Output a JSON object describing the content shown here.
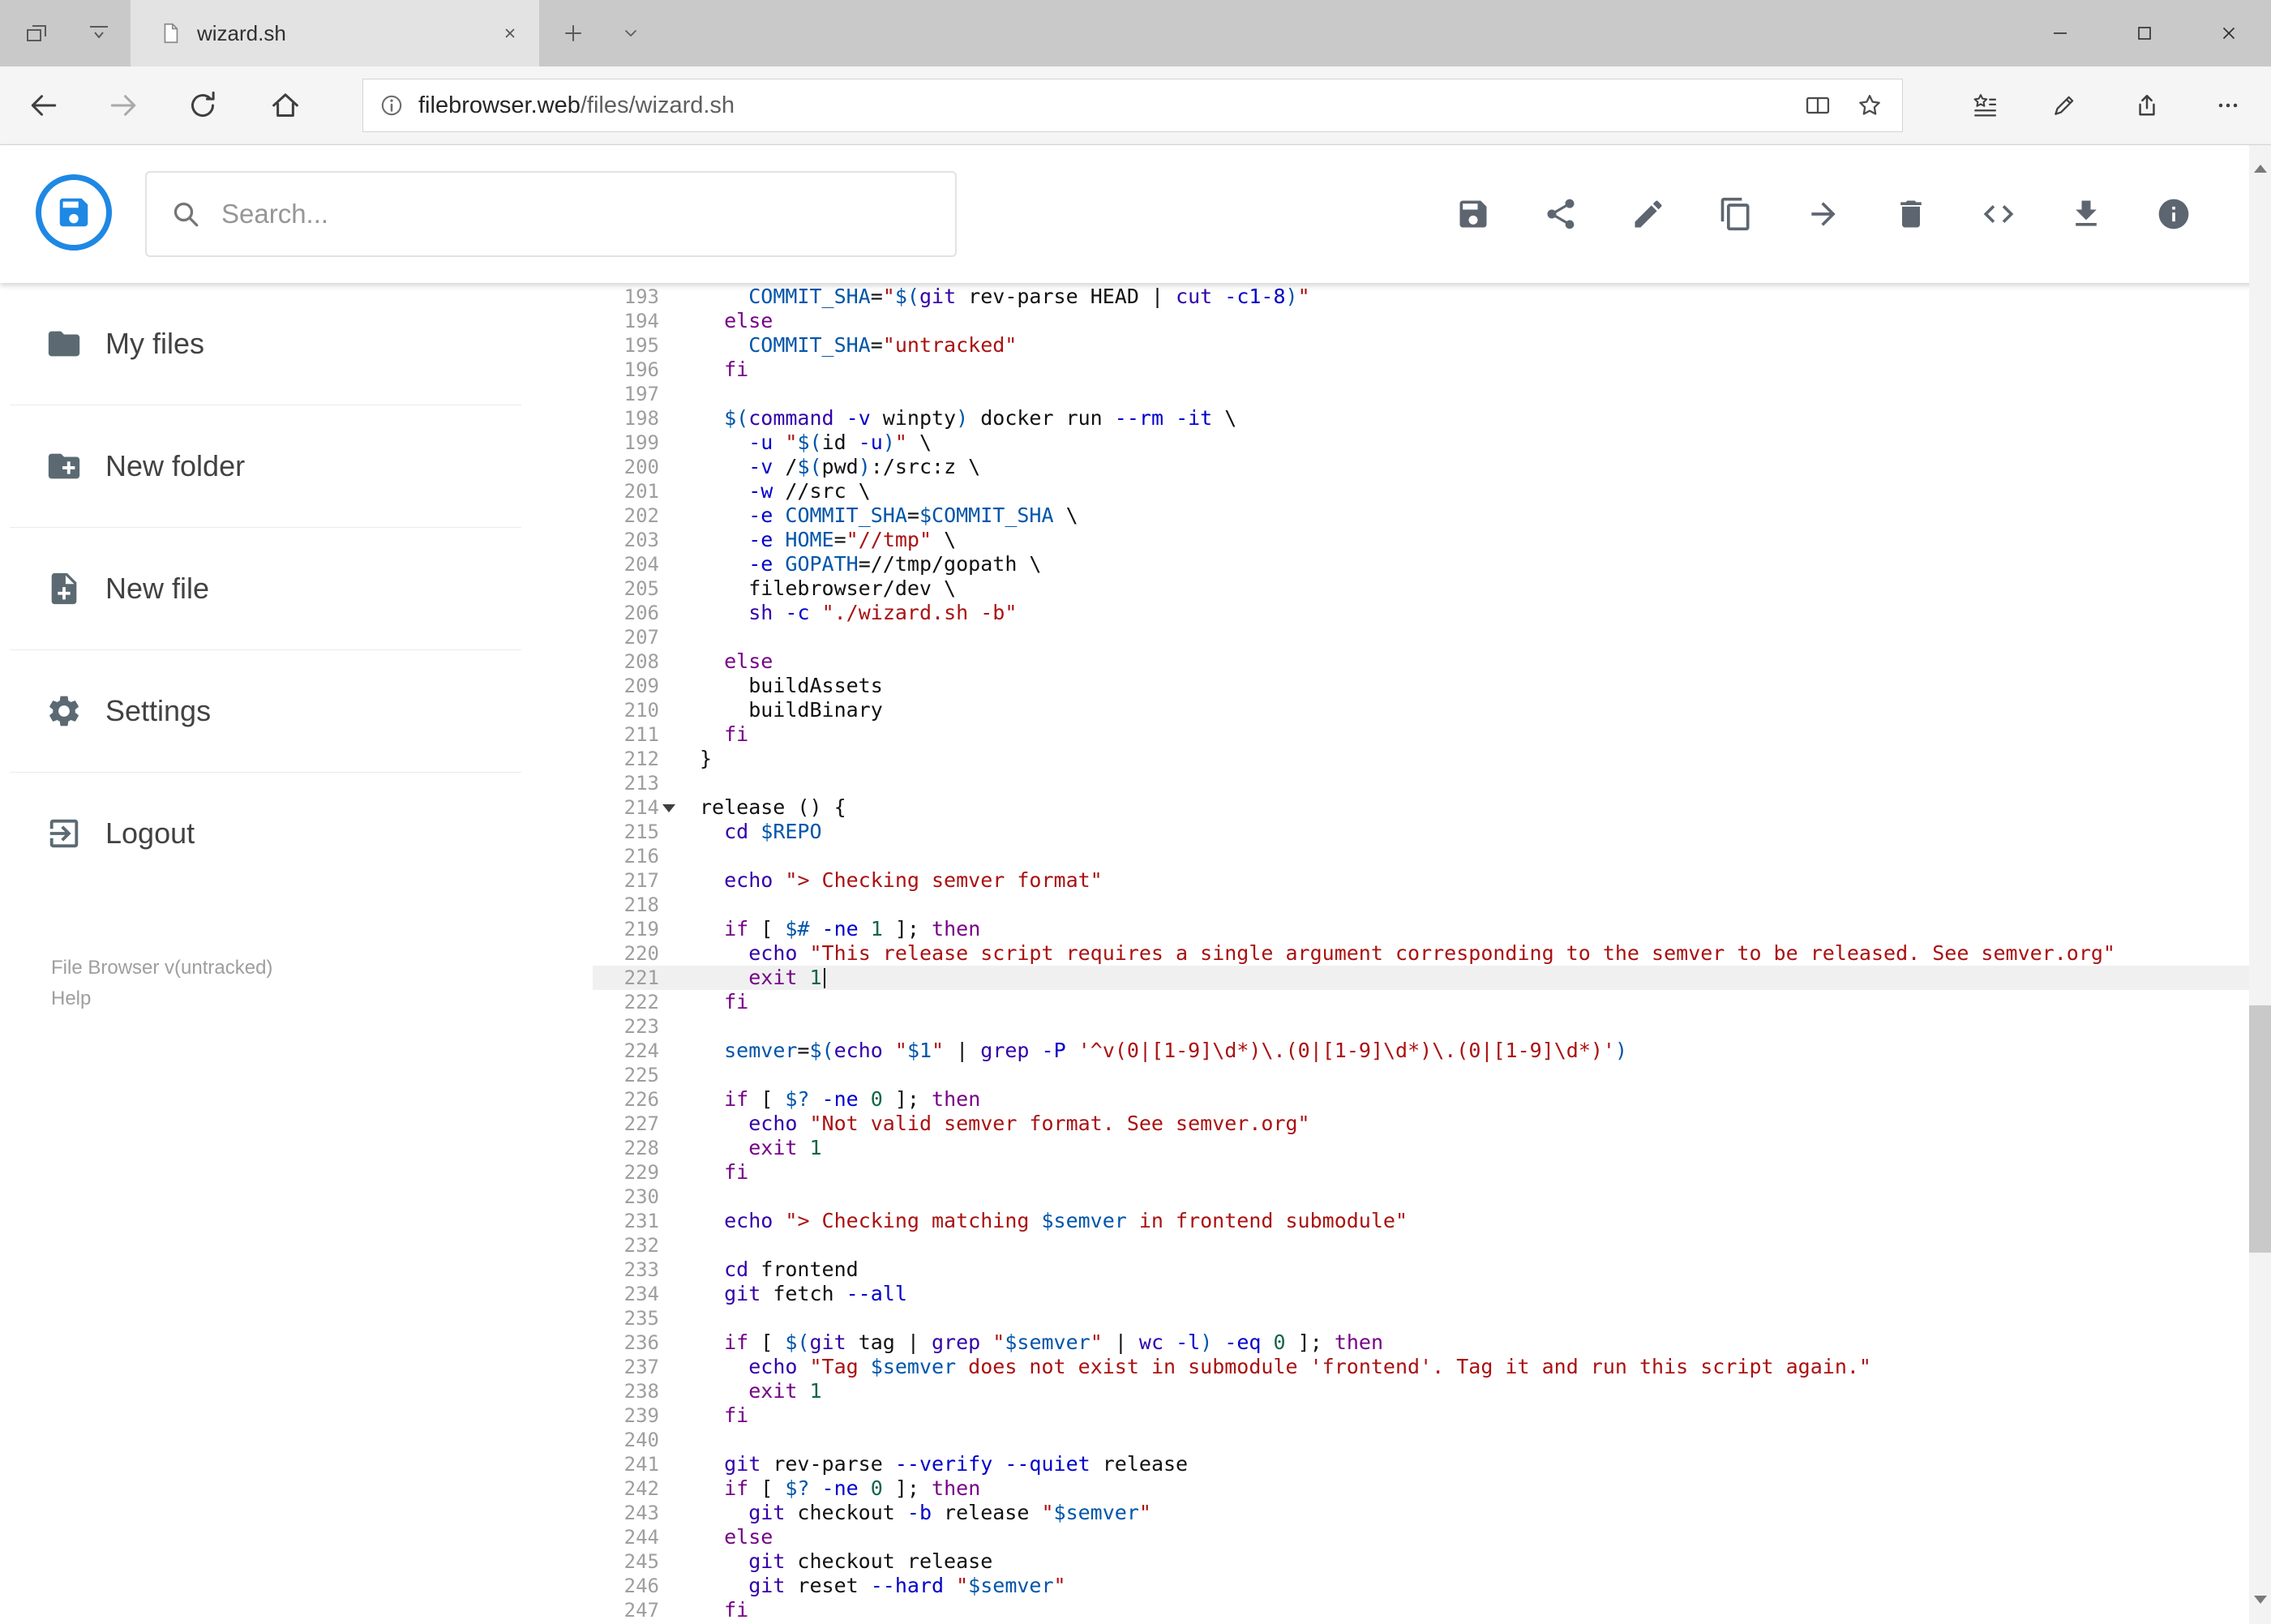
{
  "browser": {
    "tab_title": "wizard.sh",
    "url_domain": "filebrowser.web",
    "url_path": "/files/wizard.sh",
    "tabstrip_icons": [
      "set-tabs-aside",
      "tab-preview",
      "new-tab",
      "tab-dropdown"
    ],
    "nav_icons": [
      "back",
      "forward",
      "refresh",
      "home"
    ],
    "urlbar_icons": [
      "page-info",
      "reading-view",
      "add-favorite"
    ],
    "right_icons": [
      "hub",
      "web-note",
      "share",
      "more"
    ],
    "window_icons": [
      "minimize",
      "maximize",
      "close"
    ]
  },
  "app": {
    "search_placeholder": "Search...",
    "logo_color": "#1e88e5",
    "toolbar_icons": [
      "save",
      "share",
      "rename",
      "copy",
      "move",
      "delete",
      "code",
      "download",
      "info"
    ]
  },
  "sidebar": {
    "items": [
      {
        "icon": "folder",
        "label": "My files"
      },
      {
        "icon": "new-folder",
        "label": "New folder"
      },
      {
        "icon": "new-file",
        "label": "New file"
      },
      {
        "icon": "settings",
        "label": "Settings"
      },
      {
        "icon": "logout",
        "label": "Logout"
      }
    ],
    "version": "File Browser v(untracked)",
    "help": "Help"
  },
  "editor": {
    "language": "shell",
    "active_line": 221,
    "lines": [
      {
        "n": 193,
        "t": [
          [
            "p",
            "    "
          ],
          [
            "d",
            "COMMIT_SHA"
          ],
          [
            "p",
            "="
          ],
          [
            "s",
            "\""
          ],
          [
            "v",
            "$("
          ],
          [
            "b",
            "git"
          ],
          [
            "p",
            " rev-parse HEAD | "
          ],
          [
            "b",
            "cut"
          ],
          [
            "p",
            " "
          ],
          [
            "a",
            "-c1-8"
          ],
          [
            "v",
            ")"
          ],
          [
            "s",
            "\""
          ]
        ]
      },
      {
        "n": 194,
        "t": [
          [
            "p",
            "  "
          ],
          [
            "k",
            "else"
          ]
        ]
      },
      {
        "n": 195,
        "t": [
          [
            "p",
            "    "
          ],
          [
            "d",
            "COMMIT_SHA"
          ],
          [
            "p",
            "="
          ],
          [
            "s",
            "\"untracked\""
          ]
        ]
      },
      {
        "n": 196,
        "t": [
          [
            "p",
            "  "
          ],
          [
            "k",
            "fi"
          ]
        ]
      },
      {
        "n": 197,
        "t": []
      },
      {
        "n": 198,
        "t": [
          [
            "p",
            "  "
          ],
          [
            "v",
            "$("
          ],
          [
            "b",
            "command"
          ],
          [
            "p",
            " "
          ],
          [
            "a",
            "-v"
          ],
          [
            "p",
            " winpty"
          ],
          [
            "v",
            ")"
          ],
          [
            "p",
            " docker run "
          ],
          [
            "a",
            "--rm"
          ],
          [
            "p",
            " "
          ],
          [
            "a",
            "-it"
          ],
          [
            "p",
            " \\"
          ]
        ]
      },
      {
        "n": 199,
        "t": [
          [
            "p",
            "    "
          ],
          [
            "a",
            "-u"
          ],
          [
            "p",
            " "
          ],
          [
            "s",
            "\""
          ],
          [
            "v",
            "$("
          ],
          [
            "p",
            "id "
          ],
          [
            "a",
            "-u"
          ],
          [
            "v",
            ")"
          ],
          [
            "s",
            "\""
          ],
          [
            "p",
            " \\"
          ]
        ]
      },
      {
        "n": 200,
        "t": [
          [
            "p",
            "    "
          ],
          [
            "a",
            "-v"
          ],
          [
            "p",
            " /"
          ],
          [
            "v",
            "$("
          ],
          [
            "p",
            "pwd"
          ],
          [
            "v",
            ")"
          ],
          [
            "p",
            ":/src:z \\"
          ]
        ]
      },
      {
        "n": 201,
        "t": [
          [
            "p",
            "    "
          ],
          [
            "a",
            "-w"
          ],
          [
            "p",
            " //src \\"
          ]
        ]
      },
      {
        "n": 202,
        "t": [
          [
            "p",
            "    "
          ],
          [
            "a",
            "-e"
          ],
          [
            "p",
            " "
          ],
          [
            "d",
            "COMMIT_SHA"
          ],
          [
            "p",
            "="
          ],
          [
            "v",
            "$COMMIT_SHA"
          ],
          [
            "p",
            " \\"
          ]
        ]
      },
      {
        "n": 203,
        "t": [
          [
            "p",
            "    "
          ],
          [
            "a",
            "-e"
          ],
          [
            "p",
            " "
          ],
          [
            "d",
            "HOME"
          ],
          [
            "p",
            "="
          ],
          [
            "s",
            "\"//tmp\""
          ],
          [
            "p",
            " \\"
          ]
        ]
      },
      {
        "n": 204,
        "t": [
          [
            "p",
            "    "
          ],
          [
            "a",
            "-e"
          ],
          [
            "p",
            " "
          ],
          [
            "d",
            "GOPATH"
          ],
          [
            "p",
            "=//tmp/gopath \\"
          ]
        ]
      },
      {
        "n": 205,
        "t": [
          [
            "p",
            "    filebrowser/dev \\"
          ]
        ]
      },
      {
        "n": 206,
        "t": [
          [
            "p",
            "    "
          ],
          [
            "b",
            "sh"
          ],
          [
            "p",
            " "
          ],
          [
            "a",
            "-c"
          ],
          [
            "p",
            " "
          ],
          [
            "s",
            "\"./wizard.sh -b\""
          ]
        ]
      },
      {
        "n": 207,
        "t": []
      },
      {
        "n": 208,
        "t": [
          [
            "p",
            "  "
          ],
          [
            "k",
            "else"
          ]
        ]
      },
      {
        "n": 209,
        "t": [
          [
            "p",
            "    buildAssets"
          ]
        ]
      },
      {
        "n": 210,
        "t": [
          [
            "p",
            "    buildBinary"
          ]
        ]
      },
      {
        "n": 211,
        "t": [
          [
            "p",
            "  "
          ],
          [
            "k",
            "fi"
          ]
        ]
      },
      {
        "n": 212,
        "t": [
          [
            "p",
            "}"
          ]
        ]
      },
      {
        "n": 213,
        "t": []
      },
      {
        "n": 214,
        "fold": true,
        "t": [
          [
            "p",
            "release () {"
          ]
        ]
      },
      {
        "n": 215,
        "t": [
          [
            "p",
            "  "
          ],
          [
            "b",
            "cd"
          ],
          [
            "p",
            " "
          ],
          [
            "v",
            "$REPO"
          ]
        ]
      },
      {
        "n": 216,
        "t": []
      },
      {
        "n": 217,
        "t": [
          [
            "p",
            "  "
          ],
          [
            "b",
            "echo"
          ],
          [
            "p",
            " "
          ],
          [
            "s",
            "\"> Checking semver format\""
          ]
        ]
      },
      {
        "n": 218,
        "t": []
      },
      {
        "n": 219,
        "t": [
          [
            "p",
            "  "
          ],
          [
            "k",
            "if"
          ],
          [
            "p",
            " [ "
          ],
          [
            "v",
            "$#"
          ],
          [
            "p",
            " "
          ],
          [
            "a",
            "-ne"
          ],
          [
            "p",
            " "
          ],
          [
            "n",
            "1"
          ],
          [
            "p",
            " ]; "
          ],
          [
            "k",
            "then"
          ]
        ]
      },
      {
        "n": 220,
        "t": [
          [
            "p",
            "    "
          ],
          [
            "b",
            "echo"
          ],
          [
            "p",
            " "
          ],
          [
            "s",
            "\"This release script requires a single argument corresponding to the semver to be released. See semver.org\""
          ]
        ]
      },
      {
        "n": 221,
        "t": [
          [
            "p",
            "    "
          ],
          [
            "k",
            "exit"
          ],
          [
            "p",
            " "
          ],
          [
            "n",
            "1"
          ]
        ]
      },
      {
        "n": 222,
        "t": [
          [
            "p",
            "  "
          ],
          [
            "k",
            "fi"
          ]
        ]
      },
      {
        "n": 223,
        "t": []
      },
      {
        "n": 224,
        "t": [
          [
            "p",
            "  "
          ],
          [
            "d",
            "semver"
          ],
          [
            "p",
            "="
          ],
          [
            "v",
            "$("
          ],
          [
            "b",
            "echo"
          ],
          [
            "p",
            " "
          ],
          [
            "s",
            "\""
          ],
          [
            "v",
            "$1"
          ],
          [
            "s",
            "\""
          ],
          [
            "p",
            " | "
          ],
          [
            "b",
            "grep"
          ],
          [
            "p",
            " "
          ],
          [
            "a",
            "-P"
          ],
          [
            "p",
            " "
          ],
          [
            "s",
            "'^v(0|[1-9]\\d*)\\.(0|[1-9]\\d*)\\.(0|[1-9]\\d*)'"
          ],
          [
            "v",
            ")"
          ]
        ]
      },
      {
        "n": 225,
        "t": []
      },
      {
        "n": 226,
        "t": [
          [
            "p",
            "  "
          ],
          [
            "k",
            "if"
          ],
          [
            "p",
            " [ "
          ],
          [
            "v",
            "$?"
          ],
          [
            "p",
            " "
          ],
          [
            "a",
            "-ne"
          ],
          [
            "p",
            " "
          ],
          [
            "n",
            "0"
          ],
          [
            "p",
            " ]; "
          ],
          [
            "k",
            "then"
          ]
        ]
      },
      {
        "n": 227,
        "t": [
          [
            "p",
            "    "
          ],
          [
            "b",
            "echo"
          ],
          [
            "p",
            " "
          ],
          [
            "s",
            "\"Not valid semver format. See semver.org\""
          ]
        ]
      },
      {
        "n": 228,
        "t": [
          [
            "p",
            "    "
          ],
          [
            "k",
            "exit"
          ],
          [
            "p",
            " "
          ],
          [
            "n",
            "1"
          ]
        ]
      },
      {
        "n": 229,
        "t": [
          [
            "p",
            "  "
          ],
          [
            "k",
            "fi"
          ]
        ]
      },
      {
        "n": 230,
        "t": []
      },
      {
        "n": 231,
        "t": [
          [
            "p",
            "  "
          ],
          [
            "b",
            "echo"
          ],
          [
            "p",
            " "
          ],
          [
            "s",
            "\"> Checking matching "
          ],
          [
            "v",
            "$semver"
          ],
          [
            "s",
            " in frontend submodule\""
          ]
        ]
      },
      {
        "n": 232,
        "t": []
      },
      {
        "n": 233,
        "t": [
          [
            "p",
            "  "
          ],
          [
            "b",
            "cd"
          ],
          [
            "p",
            " frontend"
          ]
        ]
      },
      {
        "n": 234,
        "t": [
          [
            "p",
            "  "
          ],
          [
            "b",
            "git"
          ],
          [
            "p",
            " fetch "
          ],
          [
            "a",
            "--all"
          ]
        ]
      },
      {
        "n": 235,
        "t": []
      },
      {
        "n": 236,
        "t": [
          [
            "p",
            "  "
          ],
          [
            "k",
            "if"
          ],
          [
            "p",
            " [ "
          ],
          [
            "v",
            "$("
          ],
          [
            "b",
            "git"
          ],
          [
            "p",
            " tag | "
          ],
          [
            "b",
            "grep"
          ],
          [
            "p",
            " "
          ],
          [
            "s",
            "\""
          ],
          [
            "v",
            "$semver"
          ],
          [
            "s",
            "\""
          ],
          [
            "p",
            " | "
          ],
          [
            "b",
            "wc"
          ],
          [
            "p",
            " "
          ],
          [
            "a",
            "-l"
          ],
          [
            "v",
            ")"
          ],
          [
            "p",
            " "
          ],
          [
            "a",
            "-eq"
          ],
          [
            "p",
            " "
          ],
          [
            "n",
            "0"
          ],
          [
            "p",
            " ]; "
          ],
          [
            "k",
            "then"
          ]
        ]
      },
      {
        "n": 237,
        "t": [
          [
            "p",
            "    "
          ],
          [
            "b",
            "echo"
          ],
          [
            "p",
            " "
          ],
          [
            "s",
            "\"Tag "
          ],
          [
            "v",
            "$semver"
          ],
          [
            "s",
            " does not exist in submodule 'frontend'. Tag it and run this script again.\""
          ]
        ]
      },
      {
        "n": 238,
        "t": [
          [
            "p",
            "    "
          ],
          [
            "k",
            "exit"
          ],
          [
            "p",
            " "
          ],
          [
            "n",
            "1"
          ]
        ]
      },
      {
        "n": 239,
        "t": [
          [
            "p",
            "  "
          ],
          [
            "k",
            "fi"
          ]
        ]
      },
      {
        "n": 240,
        "t": []
      },
      {
        "n": 241,
        "t": [
          [
            "p",
            "  "
          ],
          [
            "b",
            "git"
          ],
          [
            "p",
            " rev-parse "
          ],
          [
            "a",
            "--verify"
          ],
          [
            "p",
            " "
          ],
          [
            "a",
            "--quiet"
          ],
          [
            "p",
            " release"
          ]
        ]
      },
      {
        "n": 242,
        "t": [
          [
            "p",
            "  "
          ],
          [
            "k",
            "if"
          ],
          [
            "p",
            " [ "
          ],
          [
            "v",
            "$?"
          ],
          [
            "p",
            " "
          ],
          [
            "a",
            "-ne"
          ],
          [
            "p",
            " "
          ],
          [
            "n",
            "0"
          ],
          [
            "p",
            " ]; "
          ],
          [
            "k",
            "then"
          ]
        ]
      },
      {
        "n": 243,
        "t": [
          [
            "p",
            "    "
          ],
          [
            "b",
            "git"
          ],
          [
            "p",
            " checkout "
          ],
          [
            "a",
            "-b"
          ],
          [
            "p",
            " release "
          ],
          [
            "s",
            "\""
          ],
          [
            "v",
            "$semver"
          ],
          [
            "s",
            "\""
          ]
        ]
      },
      {
        "n": 244,
        "t": [
          [
            "p",
            "  "
          ],
          [
            "k",
            "else"
          ]
        ]
      },
      {
        "n": 245,
        "t": [
          [
            "p",
            "    "
          ],
          [
            "b",
            "git"
          ],
          [
            "p",
            " checkout release"
          ]
        ]
      },
      {
        "n": 246,
        "t": [
          [
            "p",
            "    "
          ],
          [
            "b",
            "git"
          ],
          [
            "p",
            " reset "
          ],
          [
            "a",
            "--hard"
          ],
          [
            "p",
            " "
          ],
          [
            "s",
            "\""
          ],
          [
            "v",
            "$semver"
          ],
          [
            "s",
            "\""
          ]
        ]
      },
      {
        "n": 247,
        "t": [
          [
            "p",
            "  "
          ],
          [
            "k",
            "fi"
          ]
        ]
      }
    ]
  }
}
